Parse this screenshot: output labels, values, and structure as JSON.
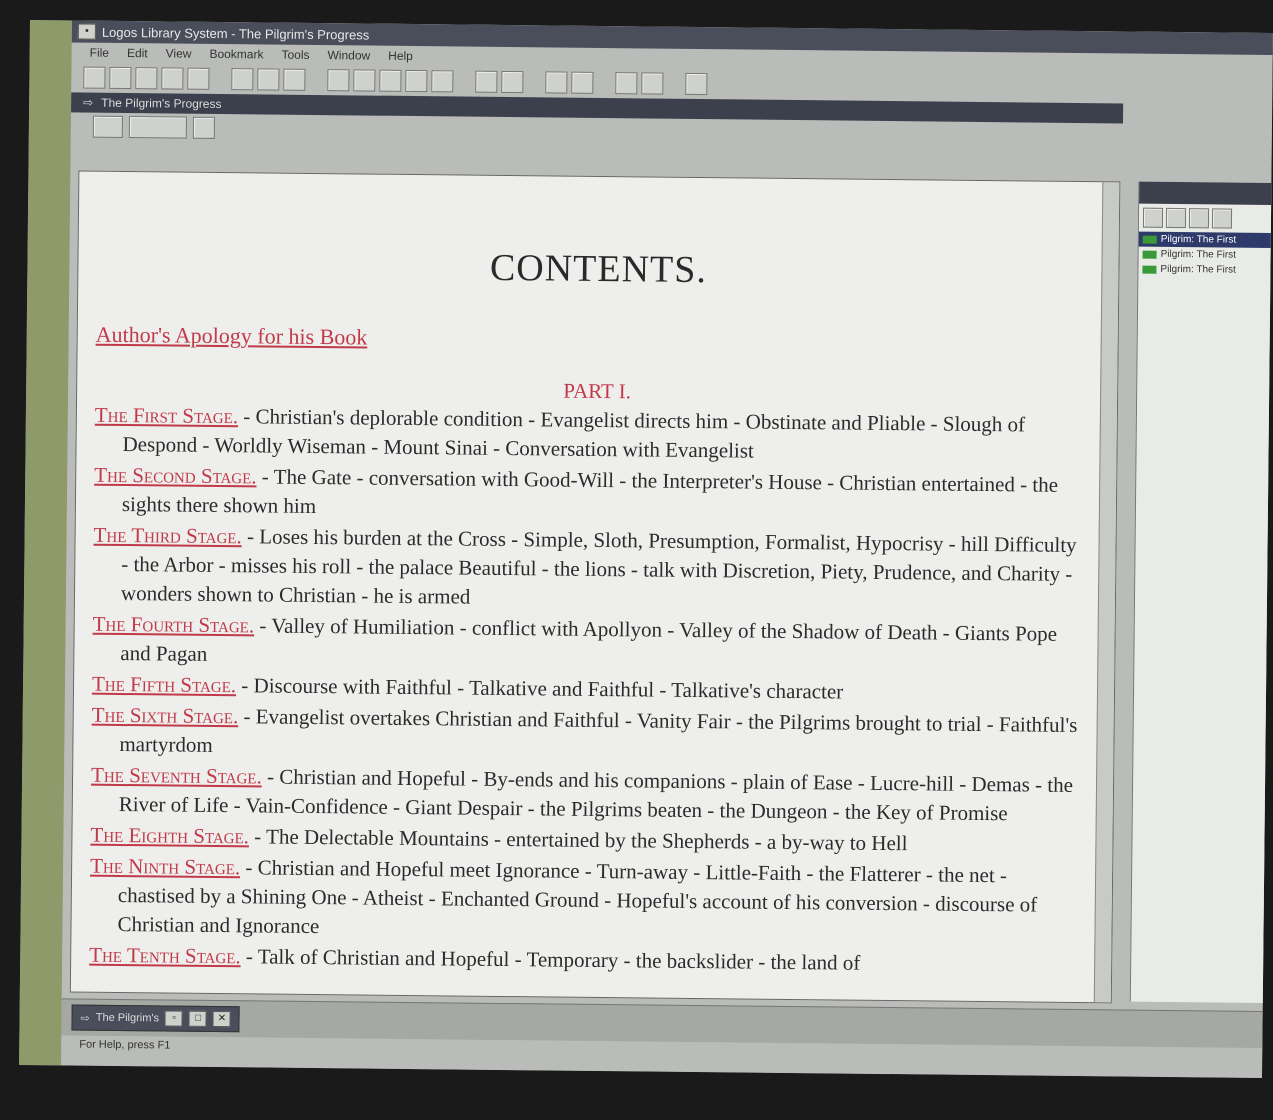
{
  "window": {
    "title": "Logos Library System - The Pilgrim's Progress"
  },
  "menu": [
    "File",
    "Edit",
    "View",
    "Bookmark",
    "Tools",
    "Window",
    "Help"
  ],
  "document": {
    "tab_title": "The Pilgrim's Progress"
  },
  "content": {
    "heading": "CONTENTS.",
    "apology": "Author's Apology for his Book",
    "part": "PART I.",
    "entries": [
      {
        "stage": "The First Stage.",
        "text": " - Christian's deplorable condition - Evangelist directs him - Obstinate and Pliable - Slough of Despond - Worldly Wiseman - Mount Sinai - Conversation with Evangelist"
      },
      {
        "stage": "The Second Stage.",
        "text": " - The Gate - conversation with Good-Will - the Interpreter's House - Christian entertained - the sights there shown him"
      },
      {
        "stage": "The Third Stage.",
        "text": " - Loses his burden at the Cross - Simple, Sloth, Presumption, Formalist, Hypocrisy - hill Difficulty - the Arbor - misses his roll - the palace Beautiful - the lions - talk with Discretion, Piety, Prudence, and Charity - wonders shown to Christian - he is armed"
      },
      {
        "stage": "The Fourth Stage.",
        "text": " - Valley of Humiliation - conflict with Apollyon - Valley of the Shadow of Death - Giants Pope and Pagan"
      },
      {
        "stage": "The Fifth Stage.",
        "text": " - Discourse with Faithful - Talkative and Faithful - Talkative's character"
      },
      {
        "stage": "The Sixth Stage.",
        "text": " - Evangelist overtakes Christian and Faithful - Vanity Fair - the Pilgrims brought to trial - Faithful's martyrdom"
      },
      {
        "stage": "The Seventh Stage.",
        "text": " - Christian and Hopeful - By-ends and his companions - plain of Ease - Lucre-hill - Demas - the River of Life - Vain-Confidence - Giant Despair - the Pilgrims beaten - the Dungeon - the Key of Promise"
      },
      {
        "stage": "The Eighth Stage.",
        "text": " - The Delectable Mountains - entertained by the Shepherds - a by-way to Hell"
      },
      {
        "stage": "The Ninth Stage.",
        "text": " - Christian and Hopeful meet Ignorance - Turn-away - Little-Faith - the Flatterer - the net - chastised by a Shining One - Atheist - Enchanted Ground - Hopeful's account of his conversion - discourse of Christian and Ignorance"
      },
      {
        "stage": "The Tenth Stage.",
        "text": " - Talk of Christian and Hopeful - Temporary - the backslider - the land of"
      }
    ]
  },
  "rightpane": {
    "items": [
      "Pilgrim: The First",
      "Pilgrim: The First",
      "Pilgrim: The First"
    ]
  },
  "taskbar": {
    "task_label": "The Pilgrim's"
  },
  "status": {
    "text": "For Help, press F1"
  },
  "colors": {
    "link": "#c23a4a",
    "titlebar": "#4a4d5a"
  }
}
